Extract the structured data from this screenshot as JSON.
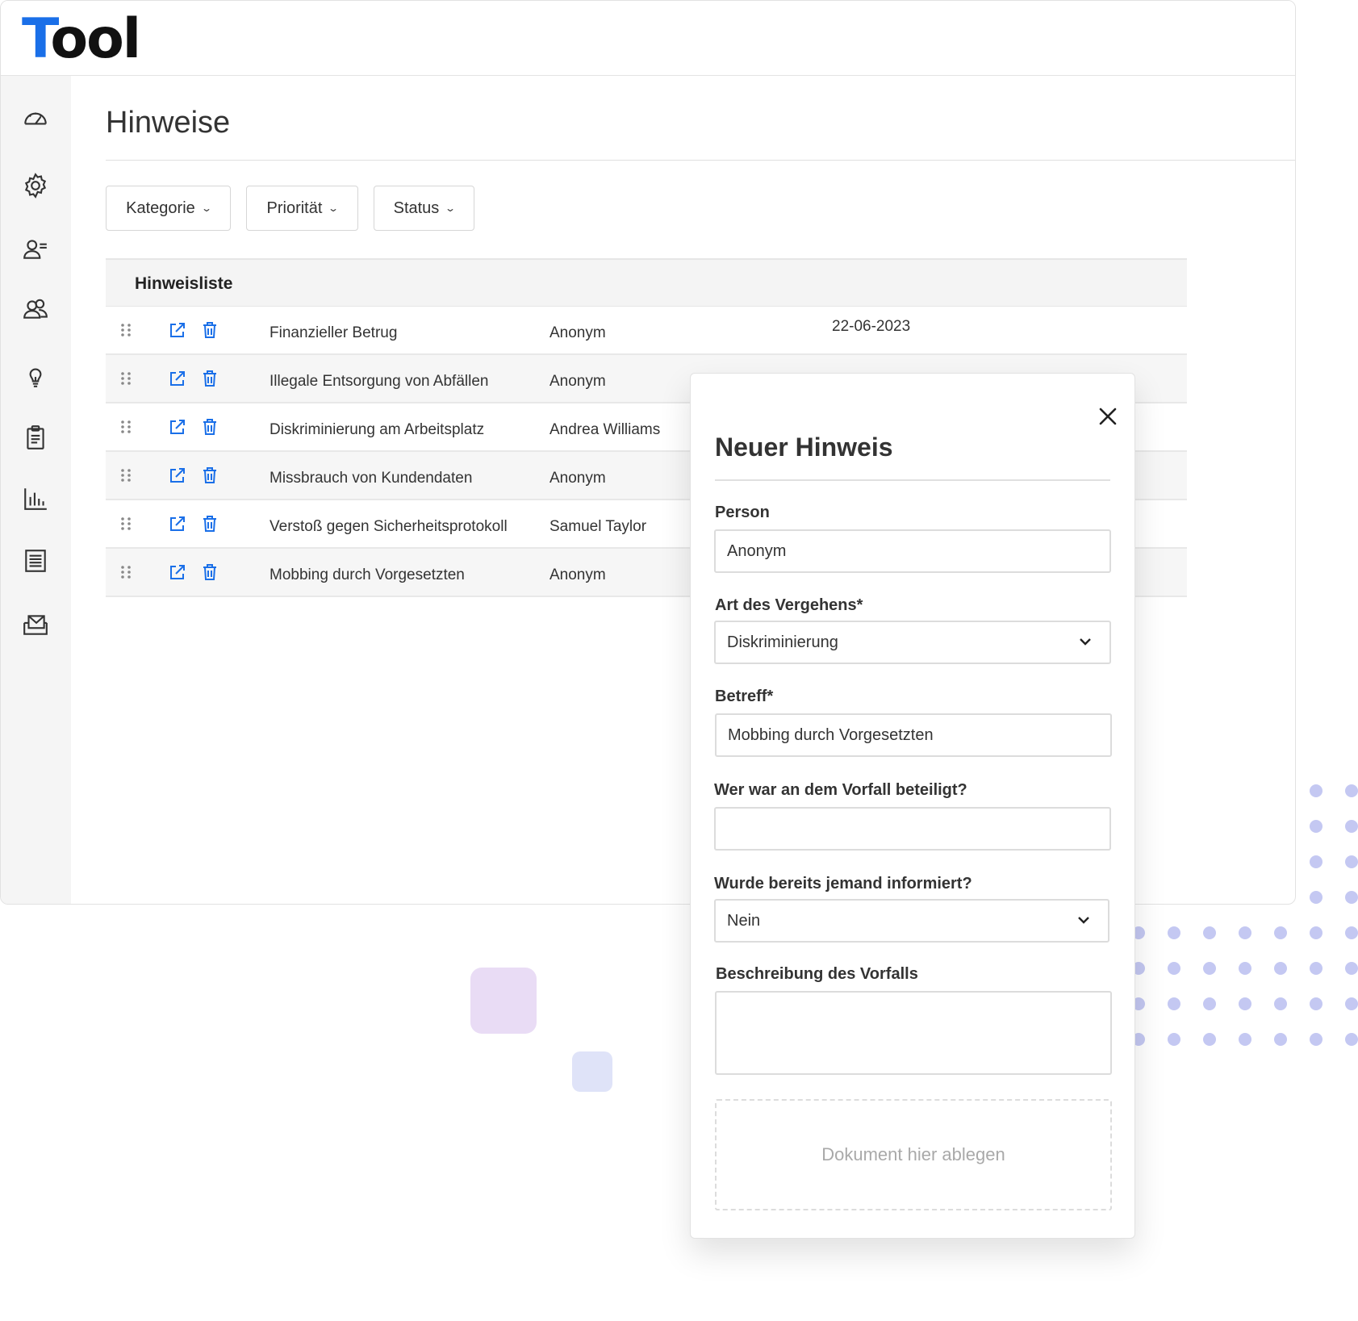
{
  "app": {
    "logo_first": "T",
    "logo_rest": "ool",
    "accent_color": "#1a6fe8"
  },
  "sidebar": {
    "items": [
      {
        "icon": "dashboard-gauge-icon"
      },
      {
        "icon": "gear-icon"
      },
      {
        "icon": "user-list-icon"
      },
      {
        "icon": "users-group-icon"
      },
      {
        "icon": "lightbulb-icon"
      },
      {
        "icon": "clipboard-icon"
      },
      {
        "icon": "bar-chart-icon"
      },
      {
        "icon": "document-list-icon"
      },
      {
        "icon": "mail-tray-icon"
      }
    ]
  },
  "page": {
    "title": "Hinweise"
  },
  "filters": {
    "category": "Kategorie",
    "priority": "Priorität",
    "status": "Status"
  },
  "list": {
    "heading": "Hinweisliste",
    "rows": [
      {
        "subject": "Finanzieller Betrug",
        "person": "Anonym",
        "date": "22-06-2023"
      },
      {
        "subject": "Illegale Entsorgung von Abfällen",
        "person": "Anonym"
      },
      {
        "subject": "Diskriminierung am Arbeitsplatz",
        "person": "Andrea Williams"
      },
      {
        "subject": "Missbrauch von Kundendaten",
        "person": "Anonym"
      },
      {
        "subject": "Verstoß gegen Sicherheitsprotokoll",
        "person": "Samuel Taylor"
      },
      {
        "subject": "Mobbing durch Vorgesetzten",
        "person": "Anonym"
      }
    ]
  },
  "modal": {
    "title": "Neuer Hinweis",
    "person_label": "Person",
    "person_value": "Anonym",
    "offense_label": "Art des Vergehens*",
    "offense_value": "Diskriminierung",
    "subject_label": "Betreff*",
    "subject_value": "Mobbing durch Vorgesetzten",
    "involved_label": "Wer war an dem Vorfall beteiligt?",
    "involved_value": "",
    "informed_label": "Wurde bereits jemand informiert?",
    "informed_value": "Nein",
    "description_label": "Beschreibung des Vorfalls",
    "dropzone_text": "Dokument hier ablegen"
  }
}
